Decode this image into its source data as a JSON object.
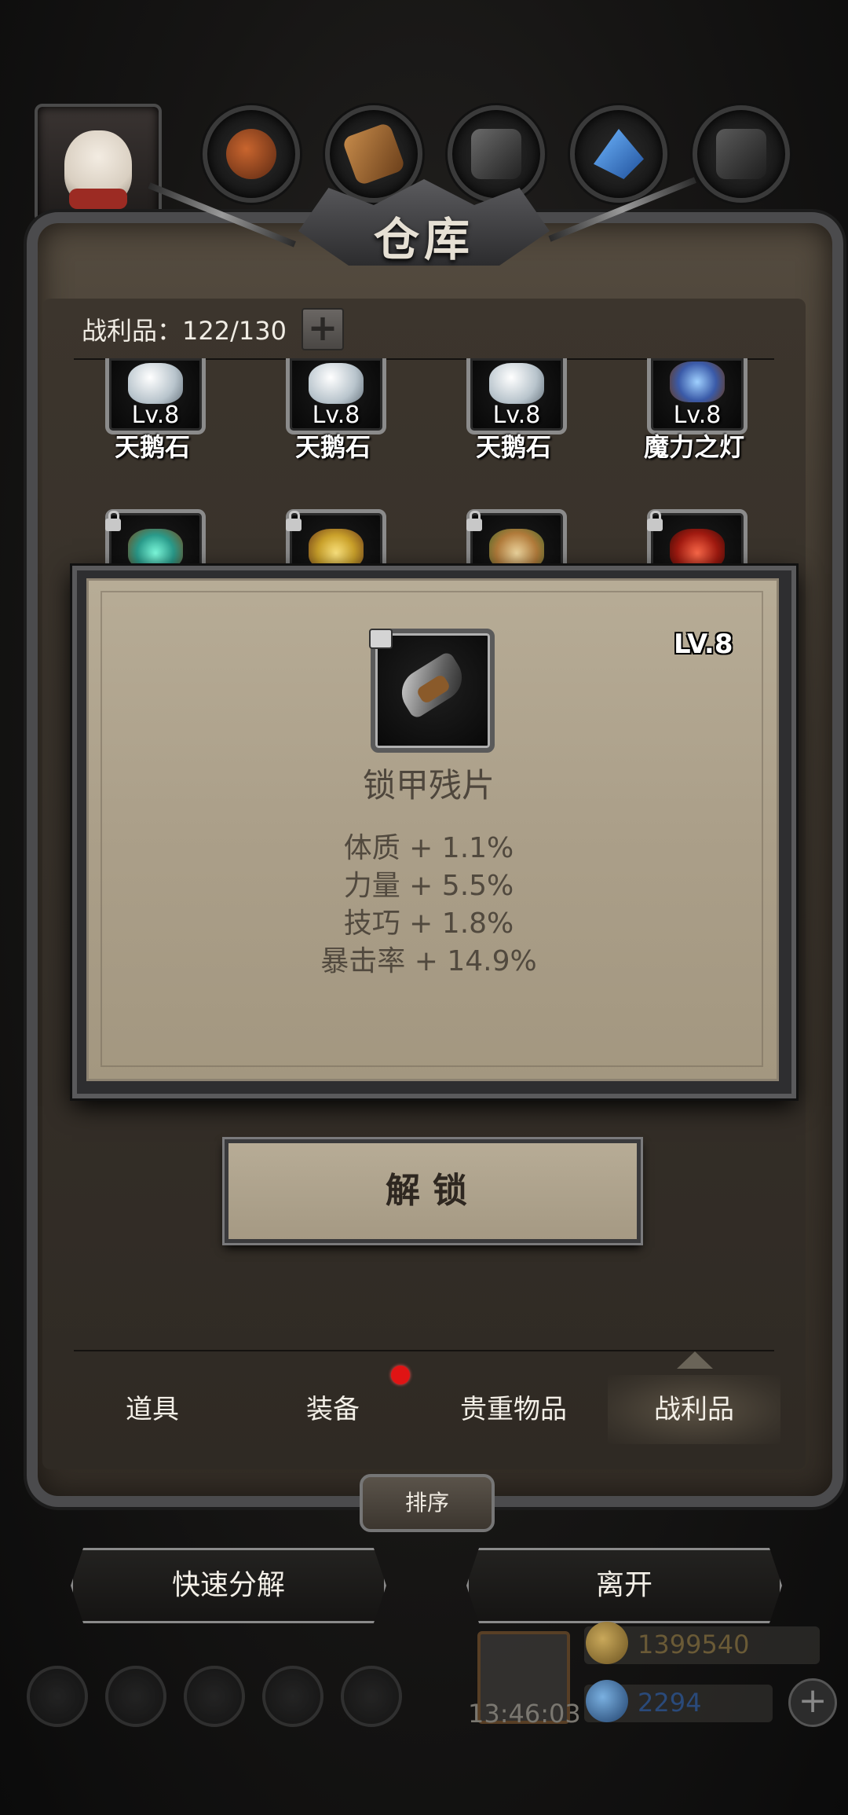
{
  "window": {
    "title": "仓库"
  },
  "header": {
    "count_label": "战利品：122/130",
    "plus": "+"
  },
  "grid": {
    "row1": [
      {
        "level": "Lv.8",
        "name": "天鹅石"
      },
      {
        "level": "Lv.8",
        "name": "天鹅石"
      },
      {
        "level": "Lv.8",
        "name": "天鹅石"
      },
      {
        "level": "Lv.8",
        "name": "魔力之灯"
      }
    ]
  },
  "popup": {
    "level": "LV.8",
    "item_name": "锁甲残片",
    "stats": [
      "体质 + 1.1%",
      "力量 + 5.5%",
      "技巧 + 1.8%",
      "暴击率 + 14.9%"
    ]
  },
  "unlock_button": {
    "label": "解锁"
  },
  "tabs": [
    {
      "label": "道具",
      "active": false
    },
    {
      "label": "装备",
      "active": false,
      "badge": true
    },
    {
      "label": "贵重物品",
      "active": false
    },
    {
      "label": "战利品",
      "active": true
    }
  ],
  "sort_button": {
    "label": "排序"
  },
  "actions": {
    "decompose": "快速分解",
    "leave": "离开"
  },
  "footer": {
    "timer": "13:46:03",
    "gold": "1399540",
    "gems": "2294"
  },
  "colors": {
    "parchment": "#b0a58f",
    "frame": "#4b4b4d",
    "badge": "#e01414",
    "gold_text": "#6a5a36",
    "gem_text": "#2a4a7a"
  },
  "icons": [
    "avatar-rabbit-icon",
    "material-tab-icon",
    "wood-tab-icon",
    "iron-tab-icon",
    "crystal-tab-icon",
    "stone-tab-icon",
    "lock-icon",
    "plus-icon",
    "gift-icon",
    "gold-coin-icon",
    "gem-icon"
  ]
}
